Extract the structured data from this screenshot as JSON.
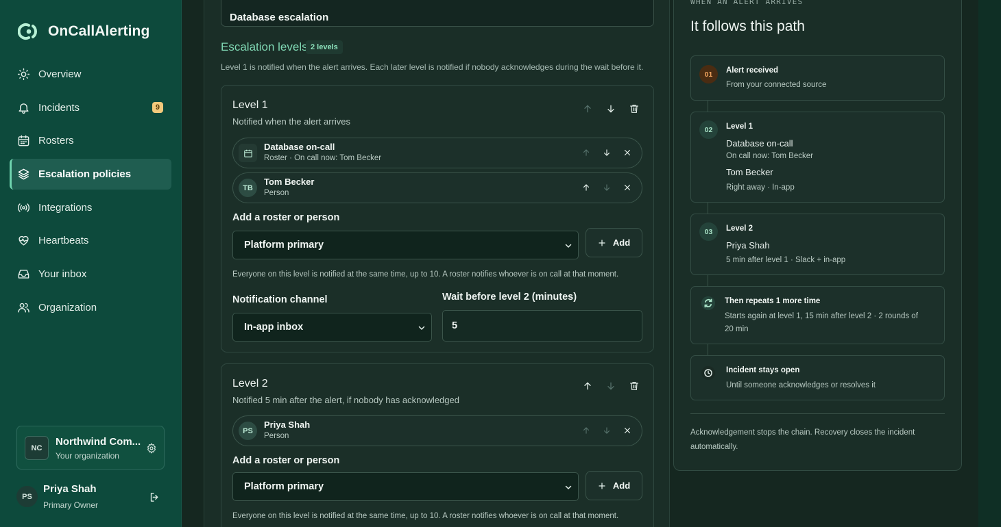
{
  "app": {
    "name": "OnCallAlerting"
  },
  "sidebar": {
    "items": [
      {
        "label": "Overview",
        "icon": "sun-icon"
      },
      {
        "label": "Incidents",
        "icon": "bell-icon",
        "badge": "9"
      },
      {
        "label": "Rosters",
        "icon": "calendar-icon"
      },
      {
        "label": "Escalation policies",
        "icon": "layers-icon",
        "active": true
      },
      {
        "label": "Integrations",
        "icon": "broadcast-icon"
      },
      {
        "label": "Heartbeats",
        "icon": "heart-pulse-icon"
      },
      {
        "label": "Your inbox",
        "icon": "inbox-icon"
      },
      {
        "label": "Organization",
        "icon": "users-icon"
      }
    ],
    "org": {
      "initials": "NC",
      "name": "Northwind Com...",
      "sub": "Your organization"
    },
    "user": {
      "initials": "PS",
      "name": "Priya Shah",
      "role": "Primary Owner"
    }
  },
  "form": {
    "policy_name": "Database escalation",
    "levels_title": "Escalation levels",
    "levels_badge": "2 levels",
    "levels_help": "Level 1 is notified when the alert arrives. Each later level is notified if nobody acknowledges during the wait before it.",
    "add_label": "Add a roster or person",
    "add_button": "Add",
    "help_text": "Everyone on this level is notified at the same time, up to 10. A roster notifies whoever is on call at that moment.",
    "levels": [
      {
        "title": "Level 1",
        "subtitle": "Notified when the alert arrives",
        "members": [
          {
            "initials": "",
            "name": "Database on-call",
            "sub": "Roster · On call now: Tom Becker"
          },
          {
            "initials": "TB",
            "name": "Tom Becker",
            "sub": "Person"
          }
        ],
        "select_value": "Platform primary",
        "channel_label": "Notification channel",
        "channel_value": "In-app inbox",
        "wait_label": "Wait before level 2 (minutes)",
        "wait_value": "5"
      },
      {
        "title": "Level 2",
        "subtitle": "Notified 5 min after the alert, if nobody has acknowledged",
        "members": [
          {
            "initials": "PS",
            "name": "Priya Shah",
            "sub": "Person"
          }
        ],
        "select_value": "Platform primary"
      }
    ]
  },
  "path": {
    "kicker": "WHEN AN ALERT ARRIVES",
    "title": "It follows this path",
    "steps": [
      {
        "num": "01",
        "title": "Alert received",
        "line1": "From your connected source"
      },
      {
        "num": "02",
        "title": "Level 1",
        "target1": "Database on-call",
        "target1_sub": "On call now: Tom Becker",
        "target2": "Tom Becker",
        "timing": "Right away · In-app"
      },
      {
        "num": "03",
        "title": "Level 2",
        "target1": "Priya Shah",
        "timing": "5 min after level 1 · Slack + in-app"
      },
      {
        "title": "Then repeats 1 more time",
        "line1": "Starts again at level 1, 15 min after level 2 · 2 rounds of",
        "line2": "20 min"
      },
      {
        "title": "Incident stays open",
        "line1": "Until someone acknowledges or resolves it"
      }
    ],
    "footer": "Acknowledgement stops the chain. Recovery closes the incident automatically."
  },
  "colors": {
    "accent": "#7fd7b3",
    "sidebar": "#0d4a3c",
    "badge": "#f2c97c"
  }
}
